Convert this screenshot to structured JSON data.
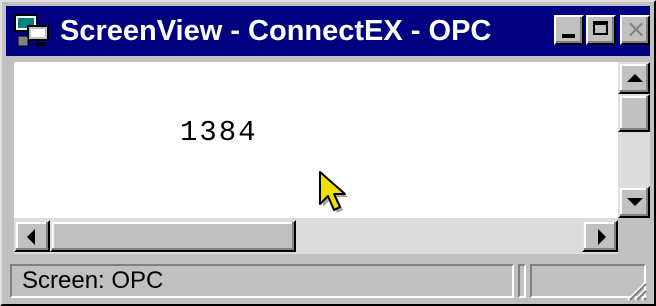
{
  "window": {
    "title": "ScreenView - ConnectEX - OPC",
    "icon": "screenview-app-icon"
  },
  "titlebar_buttons": [
    {
      "name": "minimize",
      "icon": "minimize-icon"
    },
    {
      "name": "maximize",
      "icon": "maximize-icon"
    },
    {
      "name": "close",
      "icon": "close-icon",
      "state": "disabled"
    }
  ],
  "content": {
    "value": "1384"
  },
  "status_bar": {
    "text": "Screen: OPC"
  },
  "colors": {
    "titlebar": "#000080",
    "face": "#c0c0c0",
    "content_bg": "#ffffff",
    "cursor": "#f0e000"
  }
}
